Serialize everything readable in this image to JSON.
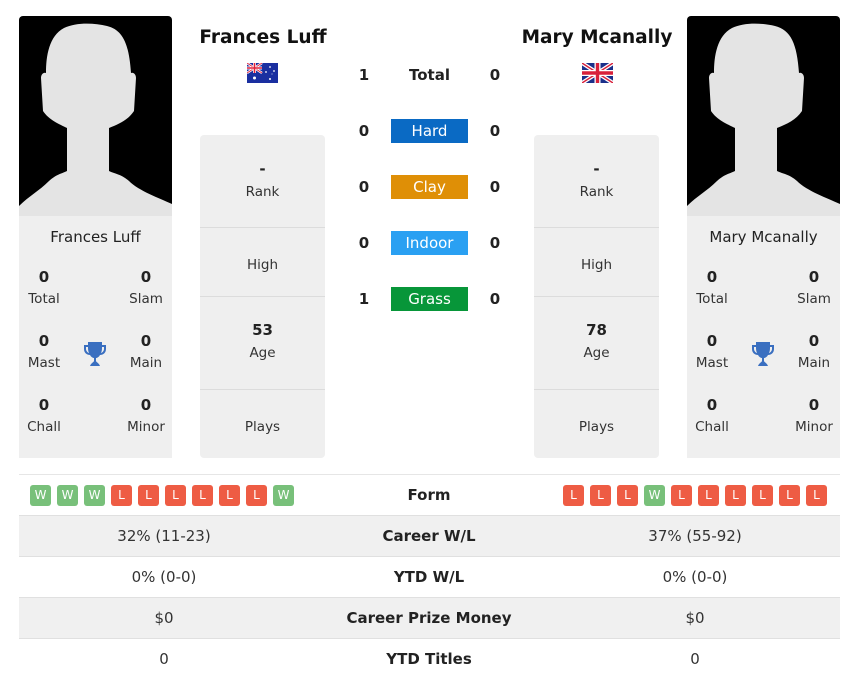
{
  "players": {
    "left": {
      "name": "Frances Luff",
      "country": "Australia",
      "flag_icon": "flag-australia",
      "titles": {
        "total": {
          "value": "0",
          "label": "Total"
        },
        "slam": {
          "value": "0",
          "label": "Slam"
        },
        "mast": {
          "value": "0",
          "label": "Mast"
        },
        "main": {
          "value": "0",
          "label": "Main"
        },
        "chall": {
          "value": "0",
          "label": "Chall"
        },
        "minor": {
          "value": "0",
          "label": "Minor"
        }
      },
      "info": {
        "rank": {
          "value": "-",
          "label": "Rank"
        },
        "high": {
          "value": "",
          "label": "High"
        },
        "age": {
          "value": "53",
          "label": "Age"
        },
        "plays": {
          "value": "",
          "label": "Plays"
        }
      },
      "form": [
        "W",
        "W",
        "W",
        "L",
        "L",
        "L",
        "L",
        "L",
        "L",
        "W"
      ],
      "career_wl": "32% (11-23)",
      "ytd_wl": "0% (0-0)",
      "career_prize": "$0",
      "ytd_titles": "0"
    },
    "right": {
      "name": "Mary Mcanally",
      "country": "United Kingdom",
      "flag_icon": "flag-united-kingdom",
      "titles": {
        "total": {
          "value": "0",
          "label": "Total"
        },
        "slam": {
          "value": "0",
          "label": "Slam"
        },
        "mast": {
          "value": "0",
          "label": "Mast"
        },
        "main": {
          "value": "0",
          "label": "Main"
        },
        "chall": {
          "value": "0",
          "label": "Chall"
        },
        "minor": {
          "value": "0",
          "label": "Minor"
        }
      },
      "info": {
        "rank": {
          "value": "-",
          "label": "Rank"
        },
        "high": {
          "value": "",
          "label": "High"
        },
        "age": {
          "value": "78",
          "label": "Age"
        },
        "plays": {
          "value": "",
          "label": "Plays"
        }
      },
      "form": [
        "L",
        "L",
        "L",
        "W",
        "L",
        "L",
        "L",
        "L",
        "L",
        "L"
      ],
      "career_wl": "37% (55-92)",
      "ytd_wl": "0% (0-0)",
      "career_prize": "$0",
      "ytd_titles": "0"
    }
  },
  "h2h": [
    {
      "label": "Total",
      "left": "1",
      "right": "0",
      "color": ""
    },
    {
      "label": "Hard",
      "left": "0",
      "right": "0",
      "color": "#0a6ac4"
    },
    {
      "label": "Clay",
      "left": "0",
      "right": "0",
      "color": "#df8f06"
    },
    {
      "label": "Indoor",
      "left": "0",
      "right": "0",
      "color": "#2aa0f2"
    },
    {
      "label": "Grass",
      "left": "1",
      "right": "0",
      "color": "#079639"
    }
  ],
  "stats_labels": {
    "form": "Form",
    "career_wl": "Career W/L",
    "ytd_wl": "YTD W/L",
    "career_prize": "Career Prize Money",
    "ytd_titles": "YTD Titles"
  },
  "colors": {
    "win": "#78c07a",
    "loss": "#ee5c44",
    "trophy": "#3a6fc0"
  }
}
